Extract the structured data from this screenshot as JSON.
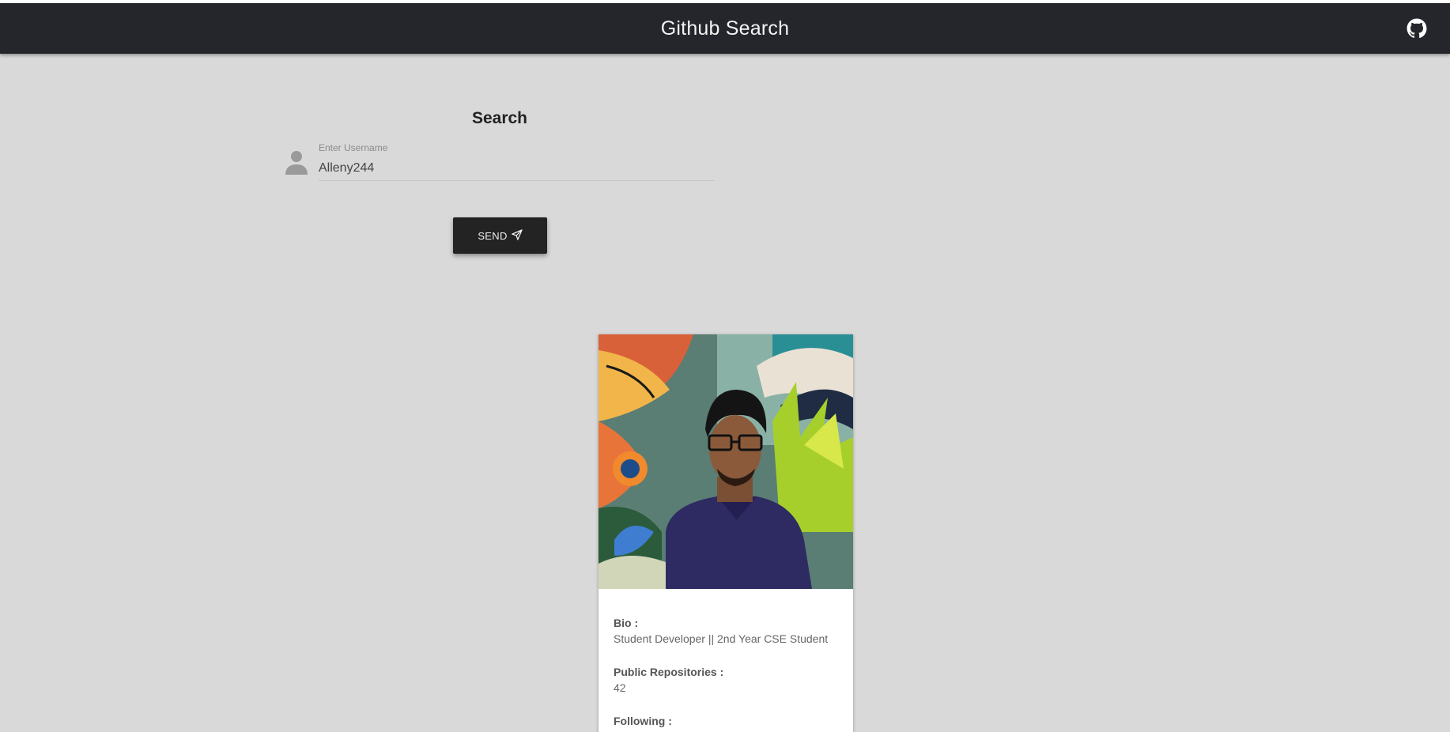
{
  "navbar": {
    "title": "Github Search",
    "icon": "github-icon"
  },
  "search": {
    "title": "Search",
    "input_label": "Enter Username",
    "input_value": "Alleny244",
    "button_label": "SEND",
    "button_icon": "paper-plane-icon",
    "user_icon": "person-icon"
  },
  "profile": {
    "photo_alt": "profile-photo",
    "bio_label": "Bio :",
    "bio_value": "Student Developer || 2nd Year CSE Student",
    "repos_label": "Public Repositories :",
    "repos_value": "42",
    "following_label": "Following :"
  },
  "colors": {
    "navbar_bg": "#24262c",
    "page_bg": "#d9d9d9",
    "button_bg": "#232323"
  }
}
